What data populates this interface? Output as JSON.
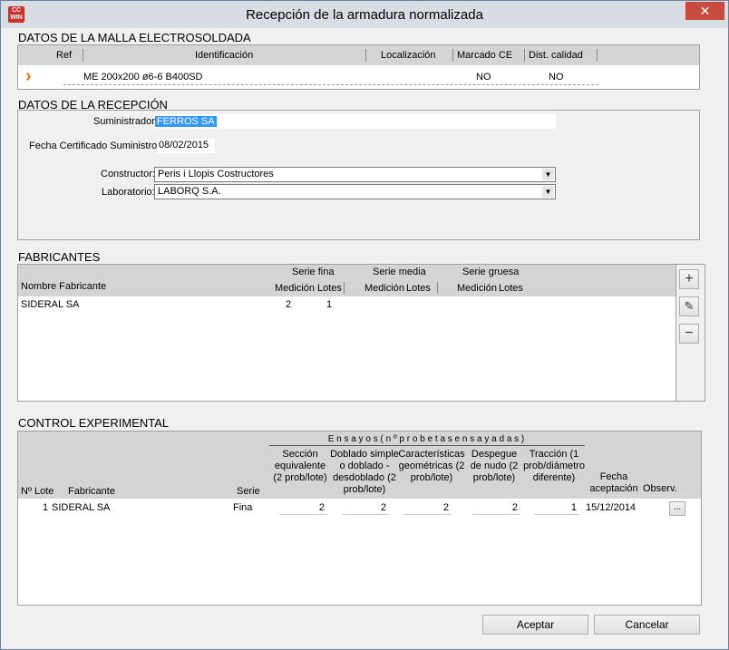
{
  "window": {
    "title": "Recepción de la armadura normalizada",
    "icon_text": "CC WIN",
    "close_glyph": "✕"
  },
  "malla": {
    "section_title": "DATOS DE LA MALLA ELECTROSOLDADA",
    "columns": [
      "Ref",
      "Identificación",
      "Localización",
      "Marcado CE",
      "Dist. calidad"
    ],
    "row": {
      "marker": "›",
      "ref": "",
      "identificacion": "ME 200x200 ø6-6 B400SD",
      "localizacion": "",
      "marcado_ce": "NO",
      "dist_calidad": "NO"
    }
  },
  "recepcion": {
    "section_title": "DATOS DE LA RECEPCIÓN",
    "suministrador_label": "Suministrador:",
    "suministrador_value": "FERROS SA",
    "fecha_label": "Fecha Certificado Suministro:",
    "fecha_value": "08/02/2015",
    "constructor_label": "Constructor:",
    "constructor_value": "Peris i Llopis Costructores",
    "laboratorio_label": "Laboratorio:",
    "laboratorio_value": "LABORQ S.A."
  },
  "fabricantes": {
    "section_title": "FABRICANTES",
    "col_nombre": "Nombre Fabricante",
    "serie_fina": "Serie fina",
    "serie_media": "Serie media",
    "serie_gruesa": "Serie gruesa",
    "medicion": "Medición",
    "lotes": "Lotes",
    "row": {
      "nombre": "SIDERAL SA",
      "fina_medicion": "2",
      "fina_lotes": "1"
    },
    "buttons": {
      "add": "+",
      "edit": "✎",
      "remove": "−"
    }
  },
  "control": {
    "section_title": "CONTROL EXPERIMENTAL",
    "ensayos_header": "E n s a y o s  ( n º  p r o b e t a s  e n s a y a d a s )",
    "col_lote": "Nº Lote",
    "col_fabricante": "Fabricante",
    "col_serie": "Serie",
    "col_seccion": "Sección equivalente (2 prob/lote)",
    "col_doblado": "Doblado simple o doblado -desdoblado (2 prob/lote)",
    "col_caract": "Características geométricas (2 prob/lote)",
    "col_despegue": "Despegue de nudo (2 prob/lote)",
    "col_traccion": "Tracción (1 prob/diámetro diferente)",
    "col_fecha": "Fecha aceptación",
    "col_observ": "Observ.",
    "row": {
      "lote": "1",
      "fabricante": "SIDERAL SA",
      "serie": "Fina",
      "seccion": "2",
      "doblado": "2",
      "caract": "2",
      "despegue": "2",
      "traccion": "1",
      "fecha": "15/12/2014",
      "observ_btn": "..."
    }
  },
  "footer": {
    "accept": "Aceptar",
    "cancel": "Cancelar"
  }
}
